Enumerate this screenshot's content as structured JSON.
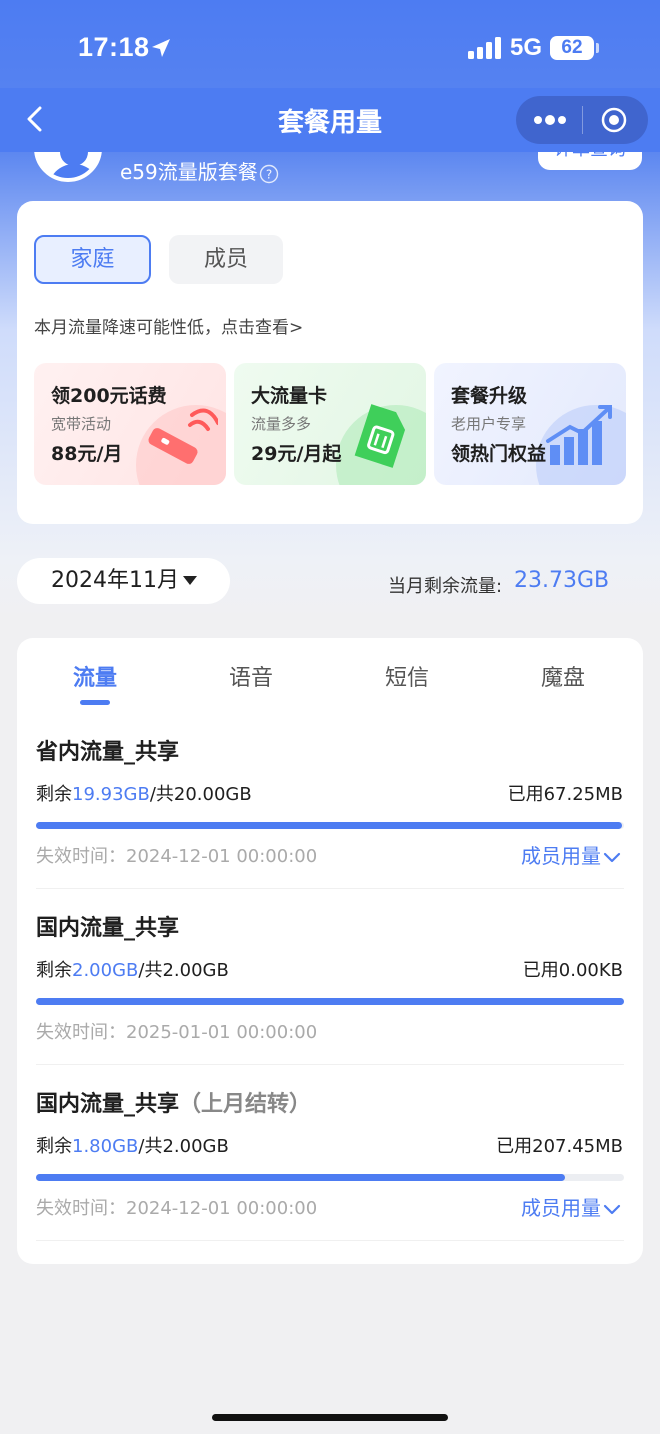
{
  "status_bar": {
    "time": "17:18",
    "network": "5G",
    "battery": "62"
  },
  "nav": {
    "title": "套餐用量"
  },
  "profile": {
    "plan_name": "e59流量版套餐",
    "detail_button": "详单查询"
  },
  "household": {
    "tabs": [
      "家庭",
      "成员"
    ],
    "tip": "本月流量降速可能性低，点击查看>",
    "promos": [
      {
        "title": "领200元话费",
        "subtitle": "宽带活动",
        "price": "88元/月",
        "icon": "router-icon"
      },
      {
        "title": "大流量卡",
        "subtitle": "流量多多",
        "price": "29元/月起",
        "icon": "sim-card-icon"
      },
      {
        "title": "套餐升级",
        "subtitle": "老用户专享",
        "price": "领热门权益",
        "icon": "growth-chart-icon"
      }
    ]
  },
  "month_selector": {
    "value": "2024年11月"
  },
  "remaining_total": {
    "label": "当月剩余流量:",
    "value": "23.73GB"
  },
  "usage_tabs": [
    "流量",
    "语音",
    "短信",
    "魔盘"
  ],
  "usage_items": [
    {
      "title": "省内流量_共享",
      "title_suffix": "",
      "remain_prefix": "剩余",
      "remain": "19.93GB",
      "total": "/共20.00GB",
      "used": "已用67.25MB",
      "remaining_fraction": 0.9966,
      "expire": "失效时间：2024-12-01 00:00:00",
      "member_link": "成员用量"
    },
    {
      "title": "国内流量_共享",
      "title_suffix": "",
      "remain_prefix": "剩余",
      "remain": "2.00GB",
      "total": "/共2.00GB",
      "used": "已用0.00KB",
      "remaining_fraction": 1.0,
      "expire": "失效时间：2025-01-01 00:00:00",
      "member_link": ""
    },
    {
      "title": "国内流量_共享",
      "title_suffix": "（上月结转）",
      "remain_prefix": "剩余",
      "remain": "1.80GB",
      "total": "/共2.00GB",
      "used": "已用207.45MB",
      "remaining_fraction": 0.9,
      "expire": "失效时间：2024-12-01 00:00:00",
      "member_link": "成员用量"
    }
  ],
  "colors": {
    "accent": "#4d7cf2",
    "muted": "#aaaaaa"
  }
}
